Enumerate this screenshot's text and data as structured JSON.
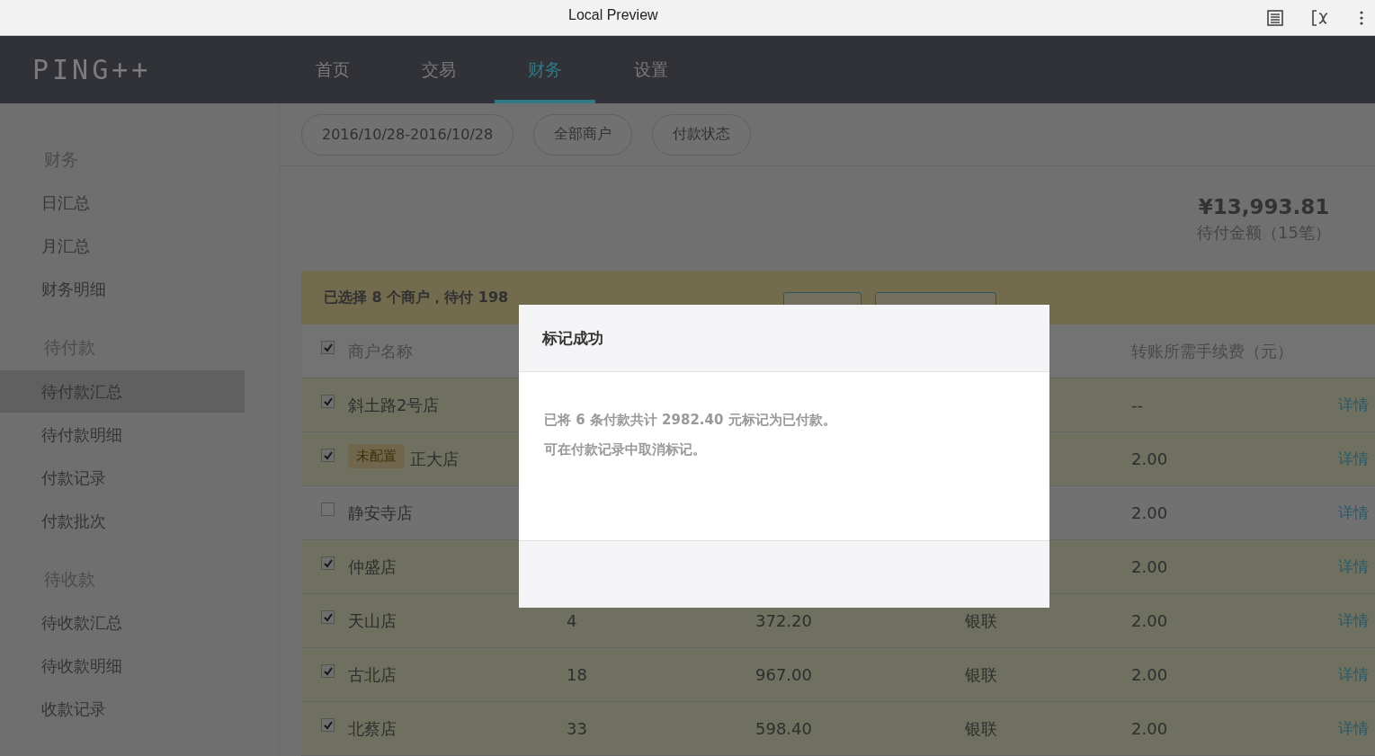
{
  "browser": {
    "title": "Local Preview"
  },
  "app": {
    "logo": "PING++",
    "nav": [
      {
        "label": "首页",
        "selected": false
      },
      {
        "label": "交易",
        "selected": false
      },
      {
        "label": "财务",
        "selected": true
      },
      {
        "label": "设置",
        "selected": false
      }
    ]
  },
  "sidebar": {
    "groups": [
      {
        "title": "财务",
        "items": [
          {
            "label": "日汇总",
            "selected": false
          },
          {
            "label": "月汇总",
            "selected": false
          },
          {
            "label": "财务明细",
            "selected": false
          }
        ]
      },
      {
        "title": "待付款",
        "items": [
          {
            "label": "待付款汇总",
            "selected": true
          },
          {
            "label": "待付款明细",
            "selected": false
          },
          {
            "label": "付款记录",
            "selected": false
          },
          {
            "label": "付款批次",
            "selected": false
          }
        ]
      },
      {
        "title": "待收款",
        "items": [
          {
            "label": "待收款汇总",
            "selected": false
          },
          {
            "label": "待收款明细",
            "selected": false
          },
          {
            "label": "收款记录",
            "selected": false
          }
        ]
      }
    ]
  },
  "filters": [
    {
      "label": "2016/10/28-2016/10/28"
    },
    {
      "label": "全部商户"
    },
    {
      "label": "付款状态"
    }
  ],
  "summary": [
    {
      "amount": "¥13,993.81",
      "label": "待付金额（15笔）"
    }
  ],
  "selection_banner": {
    "text": "已选择 8 个商户，待付 198"
  },
  "table": {
    "header_checked": true,
    "columns": {
      "name": "商户名称",
      "fee": "转账所需手续费（元）"
    },
    "rows": [
      {
        "checked": true,
        "name": "斜土路2号店",
        "fee": "--",
        "action": "详情"
      },
      {
        "checked": true,
        "tag": "未配置",
        "name": "正大店",
        "fee": "2.00",
        "action": "详情"
      },
      {
        "checked": false,
        "name": "静安寺店",
        "fee": "2.00",
        "action": "详情"
      },
      {
        "checked": true,
        "name": "仲盛店",
        "fee": "2.00",
        "action": "详情"
      },
      {
        "checked": true,
        "name": "天山店",
        "count": "4",
        "amount": "372.20",
        "channel": "银联",
        "fee": "2.00",
        "action": "详情"
      },
      {
        "checked": true,
        "name": "古北店",
        "count": "18",
        "amount": "967.00",
        "channel": "银联",
        "fee": "2.00",
        "action": "详情"
      },
      {
        "checked": true,
        "name": "北蔡店",
        "count": "33",
        "amount": "598.40",
        "channel": "银联",
        "fee": "2.00",
        "action": "详情"
      }
    ]
  },
  "dialog": {
    "title": "标记成功",
    "lines": [
      "已将 6 条付款共计 2982.40 元标记为已付款。",
      "可在付款记录中取消标记。"
    ]
  }
}
